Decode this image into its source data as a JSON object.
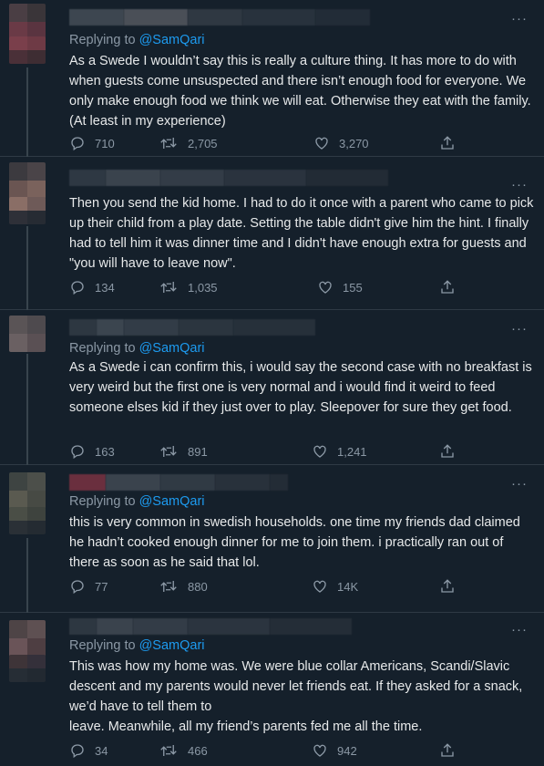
{
  "tweets": [
    {
      "reply_prefix": "Replying to ",
      "reply_handle": "@SamQari",
      "text": "As a Swede I wouldn’t say this is really a culture thing. It has more to do with when guests come unsuspected and there isn’t enough food for everyone. We only make enough food we think we will eat. Otherwise they eat with the family. (At least in my experience)",
      "replies": "710",
      "retweets": "2,705",
      "likes": "3,270"
    },
    {
      "reply_prefix": "",
      "reply_handle": "",
      "text": "Then you send the kid home. I had to do it once with a parent who came to pick up their child from a play date. Setting the table didn't give him the hint. I finally had to tell him it was dinner time and I didn't have enough extra for guests and \"you will have to leave now\".",
      "replies": "134",
      "retweets": "1,035",
      "likes": "155"
    },
    {
      "reply_prefix": "Replying to ",
      "reply_handle": "@SamQari",
      "text": "As a Swede i can confirm this, i would say the second case with no breakfast is very weird but the first one is very normal and i would find it weird to feed someone elses kid if they just over to play. Sleepover for sure they get food.",
      "replies": "163",
      "retweets": "891",
      "likes": "1,241"
    },
    {
      "reply_prefix": "Replying to ",
      "reply_handle": "@SamQari",
      "text": "this is very common in swedish households. one time my friends dad claimed he hadn’t cooked enough dinner for me to join them. i practically ran out of there as soon as he said that lol.",
      "replies": "77",
      "retweets": "880",
      "likes": "14K"
    },
    {
      "reply_prefix": "Replying to ",
      "reply_handle": "@SamQari",
      "text": "This was how my home was. We were blue collar Americans, Scandi/Slavic descent and my parents would never let friends eat. If they asked for a snack, we’d have to tell them to\nleave. Meanwhile, all my friend’s parents fed me all the time.",
      "replies": "34",
      "retweets": "466",
      "likes": "942"
    }
  ],
  "more_label": "···",
  "icons": {
    "reply": "reply-icon",
    "retweet": "retweet-icon",
    "like": "heart-icon",
    "share": "share-icon"
  },
  "colors": {
    "background": "#15202b",
    "text": "#e7e9ea",
    "muted": "#8b98a5",
    "mention": "#1d9bf0",
    "divider": "#2f3a45"
  }
}
